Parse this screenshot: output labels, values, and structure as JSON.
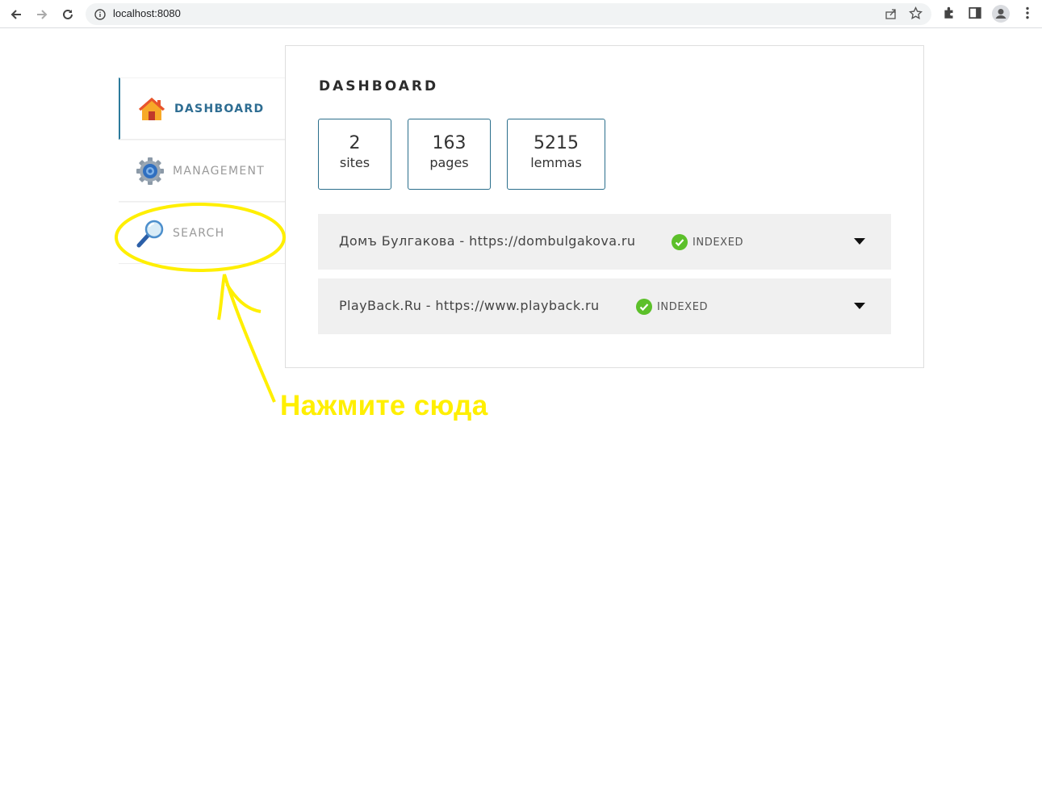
{
  "browser": {
    "url": "localhost:8080",
    "icons": [
      "back-icon",
      "forward-icon",
      "reload-icon",
      "info-icon",
      "share-icon",
      "star-icon",
      "extensions-icon",
      "side-panel-icon",
      "profile-icon",
      "menu-icon"
    ]
  },
  "sidebar": {
    "items": [
      {
        "label": "DASHBOARD",
        "icon": "home-icon",
        "active": true
      },
      {
        "label": "MANAGEMENT",
        "icon": "gear-icon",
        "active": false
      },
      {
        "label": "SEARCH",
        "icon": "magnifier-icon",
        "active": false
      }
    ]
  },
  "dashboard": {
    "title": "DASHBOARD",
    "stats": [
      {
        "value": "2",
        "label": "sites"
      },
      {
        "value": "163",
        "label": "pages"
      },
      {
        "value": "5215",
        "label": "lemmas"
      }
    ],
    "sites": [
      {
        "name": "Домъ Булгакова - https://dombulgakova.ru",
        "status": "INDEXED"
      },
      {
        "name": "PlayBack.Ru - https://www.playback.ru",
        "status": "INDEXED"
      }
    ]
  },
  "annotation": {
    "text": "Нажмите сюда",
    "color": "#ffef00"
  },
  "colors": {
    "accent": "#2b6f8c",
    "active_label": "#2e6d92",
    "ok_green": "#5cc02a"
  }
}
